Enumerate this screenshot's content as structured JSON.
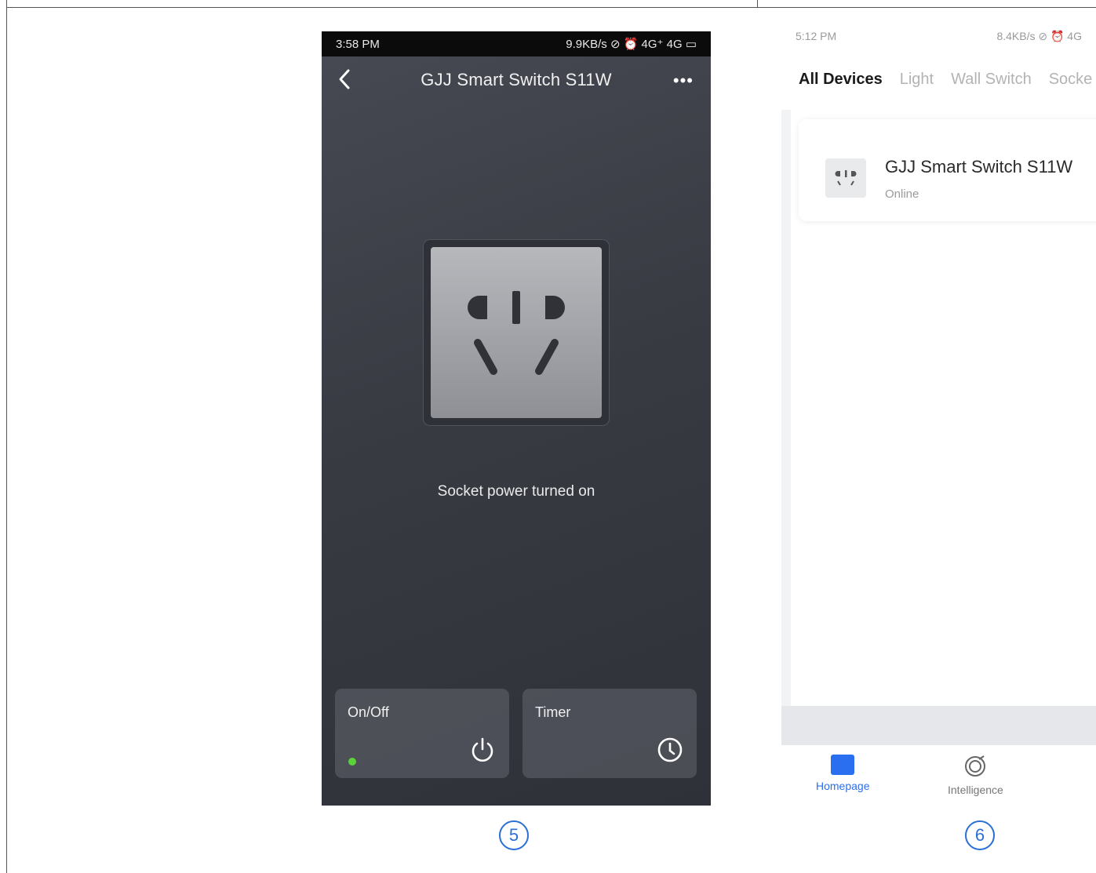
{
  "phone1": {
    "status_time": "3:58 PM",
    "status_right": "9.9KB/s ⊘ ⏰ 4G⁺ 4G ▭",
    "title": "GJJ Smart Switch S11W",
    "more": "•••",
    "status_message": "Socket power turned on",
    "cards": {
      "onoff_label": "On/Off",
      "timer_label": "Timer"
    },
    "colors": {
      "indicator": "#5cd23a"
    }
  },
  "phone2": {
    "status_time": "5:12 PM",
    "status_right": "8.4KB/s ⊘ ⏰ 4G",
    "tabs": [
      "All Devices",
      "Light",
      "Wall Switch",
      "Socke"
    ],
    "active_tab": "All Devices",
    "device": {
      "name": "GJJ Smart Switch S11W",
      "status": "Online"
    },
    "bottom_nav": {
      "home_label": "Homepage",
      "intel_label": "Intelligence"
    },
    "colors": {
      "accent": "#2a6ff0"
    }
  },
  "steps": {
    "step5": "5",
    "step6": "6"
  }
}
